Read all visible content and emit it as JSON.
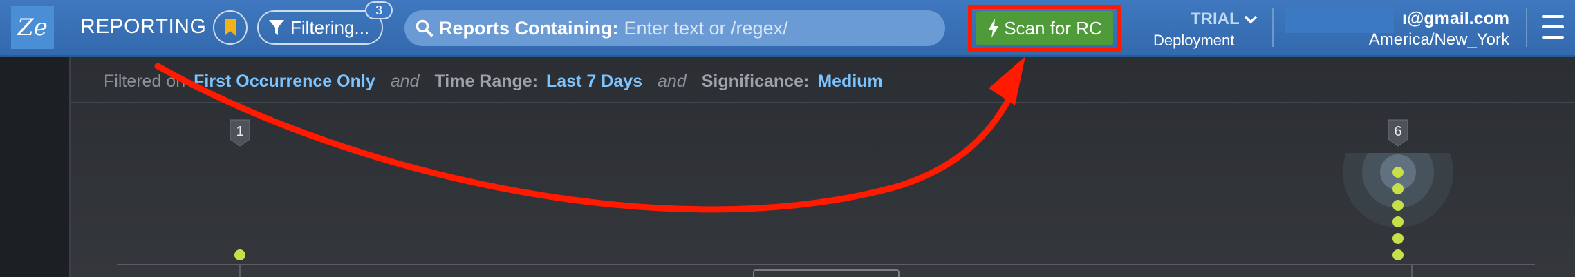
{
  "header": {
    "logo_text": "Ze",
    "title": "REPORTING",
    "filter_label": "Filtering...",
    "filter_count": "3",
    "search_label": "Reports Containing:",
    "search_placeholder": "Enter text or /regex/",
    "scan_label": "Scan for RC",
    "deployment_plan": "TRIAL",
    "deployment_label": "Deployment",
    "account_email": "ı@gmail.com",
    "account_timezone": "America/New_York"
  },
  "filter_summary": {
    "prefix": "Filtered on",
    "f1_value": "First Occurrence Only",
    "and": "and",
    "f2_label": "Time Range:",
    "f2_value": "Last 7 Days",
    "f3_label": "Significance:",
    "f3_value": "Medium"
  },
  "chart_data": {
    "type": "scatter",
    "markers": [
      {
        "label": "1",
        "count": 1
      },
      {
        "label": "6",
        "count": 6
      }
    ]
  },
  "colors": {
    "header_blue": "#3b74bb",
    "scan_green": "#4f9b3a",
    "highlight_red": "#ff1a00",
    "dot_green": "#c7e04a",
    "filter_value_blue": "#7cc4ff"
  }
}
